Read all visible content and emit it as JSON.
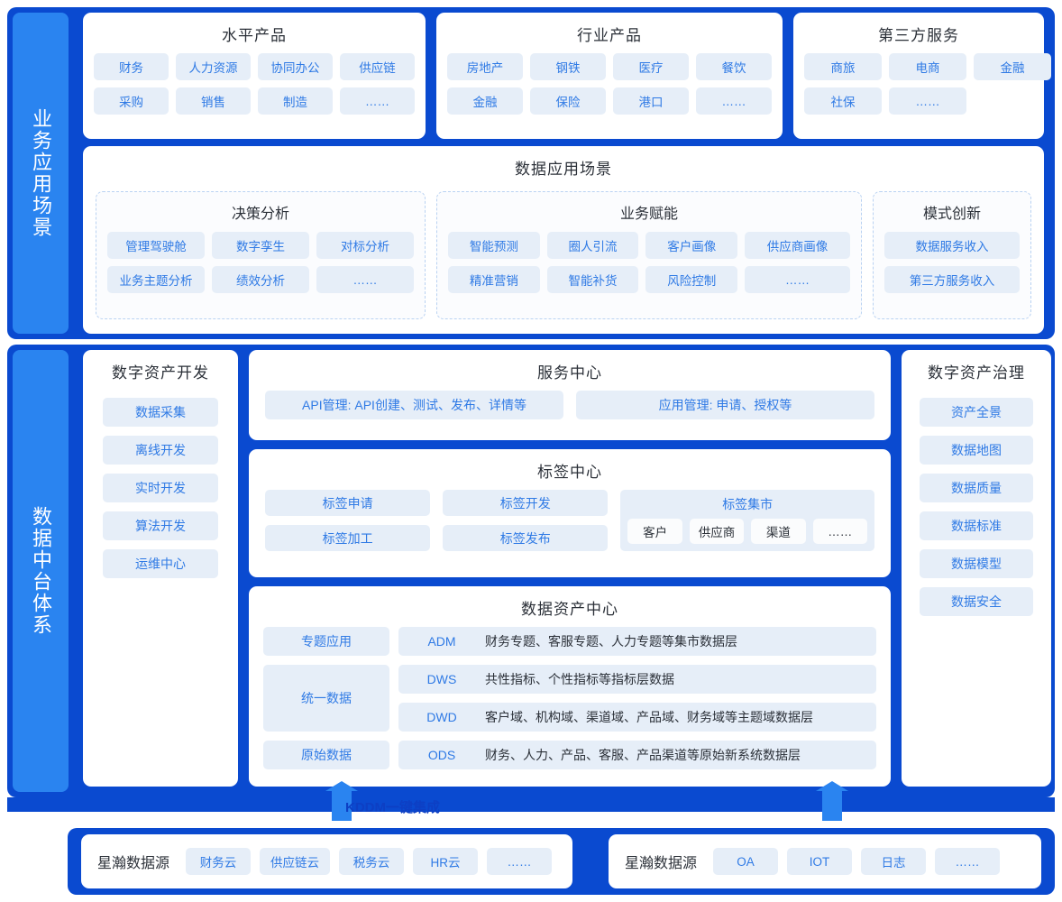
{
  "colors": {
    "frame_blue": "#0a4ad0",
    "side_blue": "#2a84f0",
    "chip_bg": "#e6eef8",
    "chip_text": "#2f7ae5",
    "title_text": "#2b3038"
  },
  "business_layer": {
    "side_label": "业务应用场景",
    "cards": [
      {
        "title": "水平产品",
        "rows": [
          [
            "财务",
            "人力资源",
            "协同办公",
            "供应链"
          ],
          [
            "采购",
            "销售",
            "制造",
            "……"
          ]
        ]
      },
      {
        "title": "行业产品",
        "rows": [
          [
            "房地产",
            "钢铁",
            "医疗",
            "餐饮"
          ],
          [
            "金融",
            "保险",
            "港口",
            "……"
          ]
        ]
      },
      {
        "title": "第三方服务",
        "rows": [
          [
            "商旅",
            "电商",
            "金融"
          ],
          [
            "社保",
            "……"
          ]
        ]
      }
    ],
    "scenarios": {
      "title": "数据应用场景",
      "groups": [
        {
          "title": "决策分析",
          "rows": [
            [
              "管理驾驶舱",
              "数字孪生",
              "对标分析"
            ],
            [
              "业务主题分析",
              "绩效分析",
              "……"
            ]
          ]
        },
        {
          "title": "业务赋能",
          "rows": [
            [
              "智能预测",
              "圈人引流",
              "客户画像",
              "供应商画像"
            ],
            [
              "精准营销",
              "智能补货",
              "风险控制",
              "……"
            ]
          ]
        },
        {
          "title": "模式创新",
          "rows": [
            [
              "数据服务收入"
            ],
            [
              "第三方服务收入"
            ]
          ]
        }
      ]
    }
  },
  "platform_layer": {
    "side_label": "数据中台体系",
    "asset_development": {
      "title": "数字资产开发",
      "items": [
        "数据采集",
        "离线开发",
        "实时开发",
        "算法开发",
        "运维中心"
      ]
    },
    "asset_governance": {
      "title": "数字资产治理",
      "items": [
        "资产全景",
        "数据地图",
        "数据质量",
        "数据标准",
        "数据模型",
        "数据安全"
      ]
    },
    "service_center": {
      "title": "服务中心",
      "items": [
        "API管理: API创建、测试、发布、详情等",
        "应用管理: 申请、授权等"
      ]
    },
    "tag_center": {
      "title": "标签中心",
      "col1": [
        "标签申请",
        "标签加工"
      ],
      "col2": [
        "标签开发",
        "标签发布"
      ],
      "market": {
        "title": "标签集市",
        "items": [
          "客户",
          "供应商",
          "渠道",
          "……"
        ]
      }
    },
    "asset_center": {
      "title": "数据资产中心",
      "tiers": [
        {
          "label": "专题应用"
        },
        {
          "label": "统一数据"
        },
        {
          "label": "原始数据"
        }
      ],
      "layers": [
        {
          "code": "ADM",
          "desc": "财务专题、客服专题、人力专题等集市数据层"
        },
        {
          "code": "DWS",
          "desc": "共性指标、个性指标等指标层数据"
        },
        {
          "code": "DWD",
          "desc": "客户域、机构域、渠道域、产品域、财务域等主题域数据层"
        },
        {
          "code": "ODS",
          "desc": "财务、人力、产品、客服、产品渠道等原始新系统数据层"
        }
      ]
    }
  },
  "connector": {
    "label": "KDDM一键集成"
  },
  "source_layer": {
    "left": {
      "title": "星瀚数据源",
      "items": [
        "财务云",
        "供应链云",
        "税务云",
        "HR云",
        "……"
      ]
    },
    "right": {
      "title": "星瀚数据源",
      "items": [
        "OA",
        "IOT",
        "日志",
        "……"
      ]
    }
  }
}
